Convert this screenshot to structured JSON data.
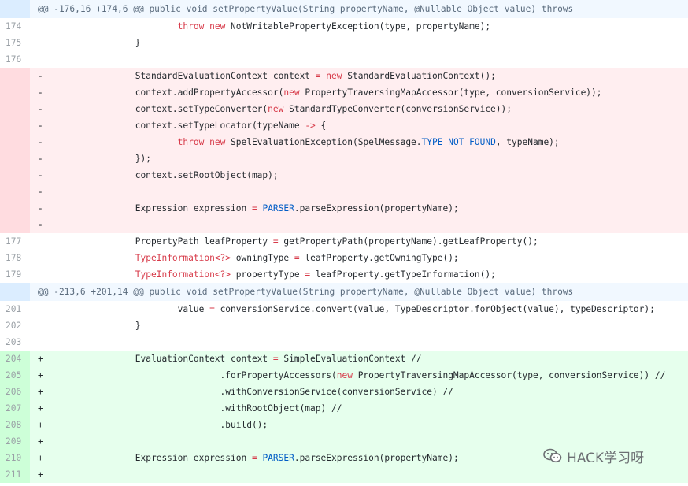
{
  "lines": [
    {
      "type": "hunk",
      "num": "",
      "marker": "",
      "tokens": [
        {
          "t": "@@ -176,16 +174,6 @@ public void setPropertyValue(String propertyName, @Nullable Object value) throws"
        }
      ]
    },
    {
      "type": "ctx",
      "num": "174",
      "marker": "",
      "tokens": [
        {
          "t": "                        "
        },
        {
          "t": "throw",
          "c": "kw"
        },
        {
          "t": " "
        },
        {
          "t": "new",
          "c": "kw"
        },
        {
          "t": " NotWritablePropertyException(type, propertyName);"
        }
      ]
    },
    {
      "type": "ctx",
      "num": "175",
      "marker": "",
      "tokens": [
        {
          "t": "                }"
        }
      ]
    },
    {
      "type": "ctx",
      "num": "176",
      "marker": "",
      "tokens": [
        {
          "t": ""
        }
      ]
    },
    {
      "type": "del",
      "num": "",
      "marker": "-",
      "tokens": [
        {
          "t": "                StandardEvaluationContext context "
        },
        {
          "t": "=",
          "c": "kw"
        },
        {
          "t": " "
        },
        {
          "t": "new",
          "c": "kw"
        },
        {
          "t": " StandardEvaluationContext();"
        }
      ]
    },
    {
      "type": "del",
      "num": "",
      "marker": "-",
      "tokens": [
        {
          "t": "                context.addPropertyAccessor("
        },
        {
          "t": "new",
          "c": "kw"
        },
        {
          "t": " PropertyTraversingMapAccessor(type, conversionService));"
        }
      ]
    },
    {
      "type": "del",
      "num": "",
      "marker": "-",
      "tokens": [
        {
          "t": "                context.setTypeConverter("
        },
        {
          "t": "new",
          "c": "kw"
        },
        {
          "t": " StandardTypeConverter(conversionService));"
        }
      ]
    },
    {
      "type": "del",
      "num": "",
      "marker": "-",
      "tokens": [
        {
          "t": "                context.setTypeLocator(typeName "
        },
        {
          "t": "->",
          "c": "kw"
        },
        {
          "t": " {"
        }
      ]
    },
    {
      "type": "del",
      "num": "",
      "marker": "-",
      "tokens": [
        {
          "t": "                        "
        },
        {
          "t": "throw",
          "c": "kw"
        },
        {
          "t": " "
        },
        {
          "t": "new",
          "c": "kw"
        },
        {
          "t": " SpelEvaluationException(SpelMessage."
        },
        {
          "t": "TYPE_NOT_FOUND",
          "c": "cn"
        },
        {
          "t": ", typeName);"
        }
      ]
    },
    {
      "type": "del",
      "num": "",
      "marker": "-",
      "tokens": [
        {
          "t": "                });"
        }
      ]
    },
    {
      "type": "del",
      "num": "",
      "marker": "-",
      "tokens": [
        {
          "t": "                context.setRootObject(map);"
        }
      ]
    },
    {
      "type": "del",
      "num": "",
      "marker": "-",
      "tokens": [
        {
          "t": ""
        }
      ]
    },
    {
      "type": "del",
      "num": "",
      "marker": "-",
      "tokens": [
        {
          "t": "                Expression expression "
        },
        {
          "t": "=",
          "c": "kw"
        },
        {
          "t": " "
        },
        {
          "t": "PARSER",
          "c": "cn"
        },
        {
          "t": ".parseExpression(propertyName);"
        }
      ]
    },
    {
      "type": "del",
      "num": "",
      "marker": "-",
      "tokens": [
        {
          "t": ""
        }
      ]
    },
    {
      "type": "ctx",
      "num": "177",
      "marker": "",
      "tokens": [
        {
          "t": "                PropertyPath leafProperty "
        },
        {
          "t": "=",
          "c": "kw"
        },
        {
          "t": " getPropertyPath(propertyName).getLeafProperty();"
        }
      ]
    },
    {
      "type": "ctx",
      "num": "178",
      "marker": "",
      "tokens": [
        {
          "t": "                "
        },
        {
          "t": "TypeInformation<?>",
          "c": "ty"
        },
        {
          "t": " owningType "
        },
        {
          "t": "=",
          "c": "kw"
        },
        {
          "t": " leafProperty.getOwningType();"
        }
      ]
    },
    {
      "type": "ctx",
      "num": "179",
      "marker": "",
      "tokens": [
        {
          "t": "                "
        },
        {
          "t": "TypeInformation<?>",
          "c": "ty"
        },
        {
          "t": " propertyType "
        },
        {
          "t": "=",
          "c": "kw"
        },
        {
          "t": " leafProperty.getTypeInformation();"
        }
      ]
    },
    {
      "type": "hunk",
      "num": "",
      "marker": "",
      "tokens": [
        {
          "t": "@@ -213,6 +201,14 @@ public void setPropertyValue(String propertyName, @Nullable Object value) throws"
        }
      ]
    },
    {
      "type": "ctx",
      "num": "201",
      "marker": "",
      "tokens": [
        {
          "t": "                        value "
        },
        {
          "t": "=",
          "c": "kw"
        },
        {
          "t": " conversionService.convert(value, TypeDescriptor.forObject(value), typeDescriptor);"
        }
      ]
    },
    {
      "type": "ctx",
      "num": "202",
      "marker": "",
      "tokens": [
        {
          "t": "                }"
        }
      ]
    },
    {
      "type": "ctx",
      "num": "203",
      "marker": "",
      "tokens": [
        {
          "t": ""
        }
      ]
    },
    {
      "type": "add",
      "num": "204",
      "marker": "+",
      "tokens": [
        {
          "t": "                EvaluationContext context "
        },
        {
          "t": "=",
          "c": "kw"
        },
        {
          "t": " SimpleEvaluationContext //"
        }
      ]
    },
    {
      "type": "add",
      "num": "205",
      "marker": "+",
      "tokens": [
        {
          "t": "                                ."
        },
        {
          "t": "forPropertyAccessors(",
          "c": "pl"
        },
        {
          "t": "new",
          "c": "kw"
        },
        {
          "t": " PropertyTraversingMapAccessor(type, conversionService)) //"
        }
      ]
    },
    {
      "type": "add",
      "num": "206",
      "marker": "+",
      "tokens": [
        {
          "t": "                                .withConversionService(conversionService) //"
        }
      ]
    },
    {
      "type": "add",
      "num": "207",
      "marker": "+",
      "tokens": [
        {
          "t": "                                .withRootObject(map) //"
        }
      ]
    },
    {
      "type": "add",
      "num": "208",
      "marker": "+",
      "tokens": [
        {
          "t": "                                .build();"
        }
      ]
    },
    {
      "type": "add",
      "num": "209",
      "marker": "+",
      "tokens": [
        {
          "t": ""
        }
      ]
    },
    {
      "type": "add",
      "num": "210",
      "marker": "+",
      "tokens": [
        {
          "t": "                Expression expression "
        },
        {
          "t": "=",
          "c": "kw"
        },
        {
          "t": " "
        },
        {
          "t": "PARSER",
          "c": "cn"
        },
        {
          "t": ".parseExpression(propertyName);"
        }
      ]
    },
    {
      "type": "add",
      "num": "211",
      "marker": "+",
      "tokens": [
        {
          "t": ""
        }
      ]
    }
  ],
  "watermark": {
    "text": "HACK学习呀",
    "icon": "wechat-icon"
  },
  "colors": {
    "hunk_bg": "#f1f8ff",
    "del_bg": "#ffeef0",
    "add_bg": "#e6ffed",
    "keyword": "#d73a49",
    "constant": "#005cc5"
  }
}
